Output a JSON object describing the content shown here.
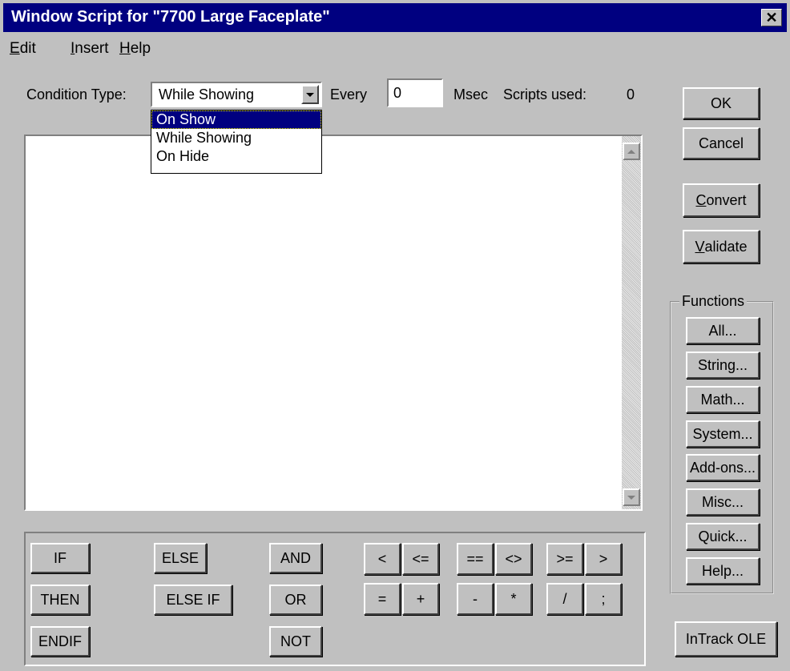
{
  "window": {
    "title": "Window Script for \"7700 Large Faceplate\"",
    "close_glyph": "✕"
  },
  "menu": [
    {
      "label": "Edit",
      "accel": "E",
      "rest": "dit"
    },
    {
      "label": "Insert",
      "accel": "I",
      "rest": "nsert"
    },
    {
      "label": "Help",
      "accel": "H",
      "rest": "elp"
    }
  ],
  "condition": {
    "label": "Condition Type:",
    "selected": "While Showing",
    "options": [
      "On Show",
      "While Showing",
      "On Hide"
    ],
    "highlighted_index": 0,
    "every_label": "Every",
    "every_value": "0",
    "msec_label": "Msec",
    "scripts_used_label": "Scripts used:",
    "scripts_used_value": "0"
  },
  "buttons": {
    "ok": "OK",
    "cancel": "Cancel",
    "convert": {
      "accel": "C",
      "rest": "onvert"
    },
    "validate": {
      "accel": "V",
      "rest": "alidate"
    },
    "intrack": "InTrack OLE"
  },
  "functions": {
    "title": "Functions",
    "items": [
      "All...",
      "String...",
      "Math...",
      "System...",
      "Add-ons...",
      "Misc...",
      "Quick...",
      "Help..."
    ]
  },
  "keywords": {
    "if": "IF",
    "then": "THEN",
    "endif": "ENDIF",
    "else": "ELSE",
    "elseif": "ELSE IF",
    "and": "AND",
    "or": "OR",
    "not": "NOT"
  },
  "operators": {
    "lt": "<",
    "le": "<=",
    "eq": "=",
    "plus": "+",
    "eqeq": "==",
    "ne": "<>",
    "minus": "-",
    "times": "*",
    "ge": ">=",
    "gt": ">",
    "div": "/",
    "semi": ";"
  }
}
